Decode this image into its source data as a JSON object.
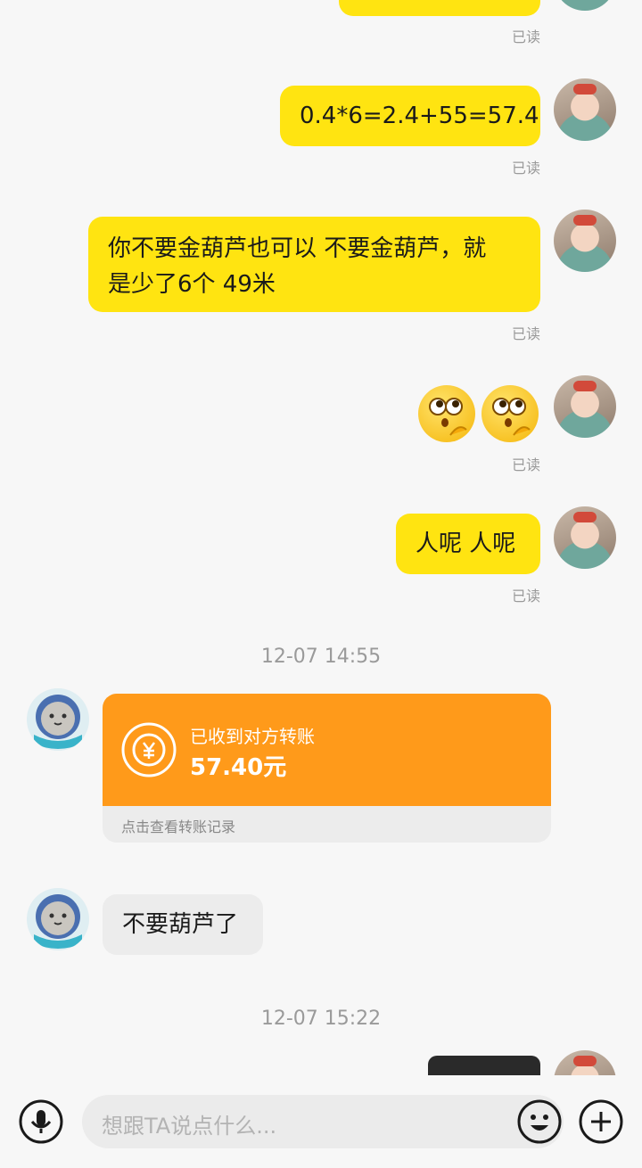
{
  "messages": {
    "read_label": "已读",
    "m1_text": "0.4*6=2.4+55=57.4",
    "m2_line1": "你不要金葫芦也可以  不要金葫芦，就",
    "m2_line2": "是少了6个  49米",
    "m3_label": "人呢 人呢",
    "timestamp1": "12-07 14:55",
    "transfer": {
      "title": "已收到对方转账",
      "amount": "57.40元",
      "footer": "点击查看转账记录",
      "icon": "yuan-transfer-icon",
      "color": "#ff9a1a"
    },
    "m4_text": "不要葫芦了",
    "timestamp2": "12-07 15:22"
  },
  "input_bar": {
    "placeholder": "想跟TA说点什么...",
    "voice_icon": "microphone-icon",
    "emoji_icon": "smiley-icon",
    "add_icon": "plus-icon"
  },
  "colors": {
    "my_bubble": "#ffe411",
    "their_bubble": "#ececec",
    "background": "#f7f7f7"
  }
}
